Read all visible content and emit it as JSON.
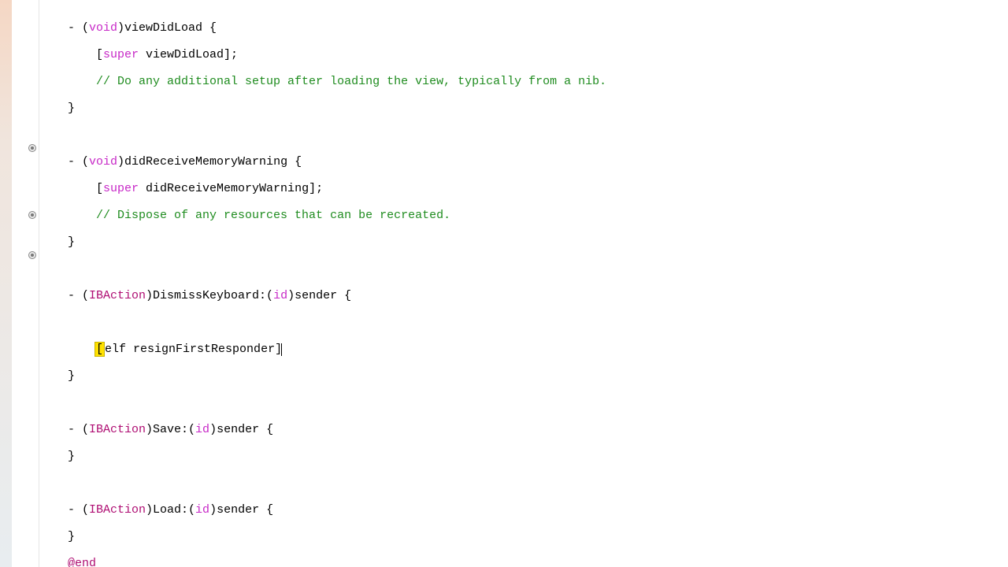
{
  "colors": {
    "keyword_pink": "#c728c7",
    "keyword_magenta": "#af0e73",
    "comment_green": "#1f8c1f",
    "highlight_yellow": "#ffe100"
  },
  "gutter_markers": [
    {
      "line_index": 10
    },
    {
      "line_index": 15
    },
    {
      "line_index": 18
    }
  ],
  "code": {
    "l0": {
      "pre": "- (",
      "void": "void",
      "post": ")viewDidLoad {"
    },
    "l1": {
      "pre": "    [",
      "super": "super",
      "post": " viewDidLoad];"
    },
    "l2": {
      "indent": "    ",
      "comment": "// Do any additional setup after loading the view, typically from a nib."
    },
    "l3": {
      "text": "}"
    },
    "l4": {
      "text": ""
    },
    "l5": {
      "pre": "- (",
      "void": "void",
      "post": ")didReceiveMemoryWarning {"
    },
    "l6": {
      "pre": "    [",
      "super": "super",
      "post": " didReceiveMemoryWarning];"
    },
    "l7": {
      "indent": "    ",
      "comment": "// Dispose of any resources that can be recreated."
    },
    "l8": {
      "text": "}"
    },
    "l9": {
      "text": ""
    },
    "l10": {
      "pre": "- (",
      "ib": "IBAction",
      "mid": ")DismissKeyboard:(",
      "id": "id",
      "post": ")sender {"
    },
    "l11": {
      "text": ""
    },
    "l12": {
      "indent": "    ",
      "hl": "[",
      "rest": "elf resignFirstResponder]"
    },
    "l13": {
      "text": "}"
    },
    "l14": {
      "text": ""
    },
    "l15": {
      "pre": "- (",
      "ib": "IBAction",
      "mid": ")Save:(",
      "id": "id",
      "post": ")sender {"
    },
    "l16": {
      "text": "}"
    },
    "l17": {
      "text": ""
    },
    "l18": {
      "pre": "- (",
      "ib": "IBAction",
      "mid": ")Load:(",
      "id": "id",
      "post": ")sender {"
    },
    "l19": {
      "text": "}"
    },
    "l20": {
      "end": "@end"
    }
  }
}
